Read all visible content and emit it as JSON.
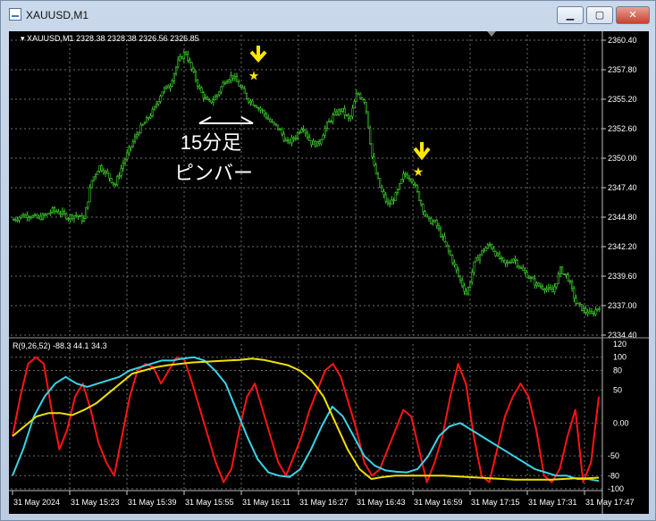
{
  "window": {
    "title": "XAUUSD,M1",
    "buttons": {
      "minimize": "▁",
      "maximize": "▢",
      "close": "✕"
    }
  },
  "main_chart": {
    "header": "XAUUSD,M1  2328.38 2328.38 2326.56 2326.85",
    "price_labels": [
      "2360.40",
      "2357.80",
      "2355.20",
      "2352.60",
      "2350.00",
      "2347.40",
      "2344.80",
      "2342.20",
      "2339.60",
      "2337.00",
      "2334.40"
    ],
    "annotation_line1": "15分足",
    "annotation_line2": "ピンバー",
    "colors": {
      "candles": "#3dcc2a",
      "grid": "#6e6e6e",
      "marker": "#ffe600",
      "text": "#ffffff"
    }
  },
  "indicator": {
    "header": "R(9,26,52) -88.3 44.1 34.3",
    "levels": [
      "120",
      "100",
      "80",
      "50",
      "0.00",
      "-50",
      "-80",
      "-100"
    ],
    "series_colors": {
      "fast": "#ff1414",
      "mid": "#38d4e8",
      "slow": "#f0e000"
    }
  },
  "time_labels": [
    "31 May 2024",
    "31 May 15:23",
    "31 May 15:39",
    "31 May 15:55",
    "31 May 16:11",
    "31 May 16:27",
    "31 May 16:43",
    "31 May 16:59",
    "31 May 17:15",
    "31 May 17:31",
    "31 May 17:47"
  ],
  "chart_data": [
    {
      "type": "candlestick",
      "title": "XAUUSD,M1",
      "ylim": [
        2334.4,
        2360.4
      ],
      "close_path": [
        2344.6,
        2344.9,
        2345.0,
        2344.7,
        2344.9,
        2345.4,
        2345.2,
        2344.8,
        2345.0,
        2344.5,
        2348.0,
        2349.3,
        2348.6,
        2347.6,
        2349.5,
        2351.0,
        2352.4,
        2353.3,
        2354.3,
        2355.9,
        2356.4,
        2358.4,
        2359.4,
        2357.5,
        2355.8,
        2354.8,
        2355.5,
        2356.8,
        2357.3,
        2356.3,
        2355.2,
        2354.7,
        2354.0,
        2353.1,
        2352.6,
        2351.3,
        2351.8,
        2352.9,
        2351.4,
        2351.2,
        2352.8,
        2353.8,
        2354.3,
        2353.3,
        2355.8,
        2355.0,
        2349.6,
        2347.2,
        2345.8,
        2346.8,
        2348.6,
        2348.2,
        2346.3,
        2344.5,
        2344.3,
        2342.8,
        2341.3,
        2339.5,
        2338.0,
        2340.8,
        2341.8,
        2342.4,
        2341.3,
        2340.6,
        2341.2,
        2340.2,
        2339.5,
        2338.8,
        2338.6,
        2338.2,
        2340.2,
        2339.4,
        2337.2,
        2336.6,
        2336.2,
        2337.0
      ],
      "stars_at_price": [
        2357.3,
        2348.8
      ]
    },
    {
      "type": "line",
      "title": "R(9,26,52)",
      "ylim": [
        -100,
        120
      ],
      "series": [
        {
          "values": [
            -20,
            40,
            90,
            100,
            90,
            20,
            -40,
            -10,
            40,
            60,
            20,
            -30,
            -60,
            -80,
            -20,
            40,
            80,
            90,
            85,
            60,
            80,
            100,
            96,
            60,
            20,
            -20,
            -60,
            -90,
            -70,
            -10,
            40,
            60,
            20,
            -20,
            -60,
            -80,
            -50,
            -20,
            20,
            50,
            80,
            90,
            70,
            30,
            -10,
            -60,
            -80,
            -70,
            -40,
            -10,
            20,
            10,
            -40,
            -90,
            -60,
            -20,
            40,
            90,
            60,
            -20,
            -80,
            -90,
            -40,
            10,
            40,
            60,
            40,
            -10,
            -80,
            -90,
            -70,
            -20,
            20,
            -90,
            -60,
            40
          ]
        },
        {
          "values": [
            -80,
            -40,
            10,
            40,
            60,
            70,
            60,
            55,
            60,
            65,
            70,
            80,
            85,
            90,
            95,
            95,
            98,
            100,
            95,
            80,
            60,
            20,
            -20,
            -55,
            -75,
            -80,
            -82,
            -70,
            -40,
            -5,
            25,
            10,
            -20,
            -50,
            -65,
            -72,
            -74,
            -75,
            -70,
            -50,
            -20,
            -5,
            0,
            -10,
            -20,
            -30,
            -40,
            -50,
            -60,
            -70,
            -75,
            -80,
            -80,
            -85,
            -85,
            -88
          ]
        },
        {
          "values": [
            -20,
            -5,
            10,
            15,
            15,
            12,
            20,
            30,
            45,
            60,
            75,
            80,
            85,
            88,
            90,
            92,
            93,
            94,
            95,
            96,
            98,
            96,
            92,
            88,
            80,
            65,
            40,
            0,
            -40,
            -70,
            -85,
            -82,
            -80,
            -80,
            -80,
            -80,
            -80,
            -81,
            -82,
            -83,
            -84,
            -85,
            -86,
            -86,
            -86,
            -86,
            -85,
            -84,
            -84,
            -83
          ]
        }
      ]
    }
  ]
}
